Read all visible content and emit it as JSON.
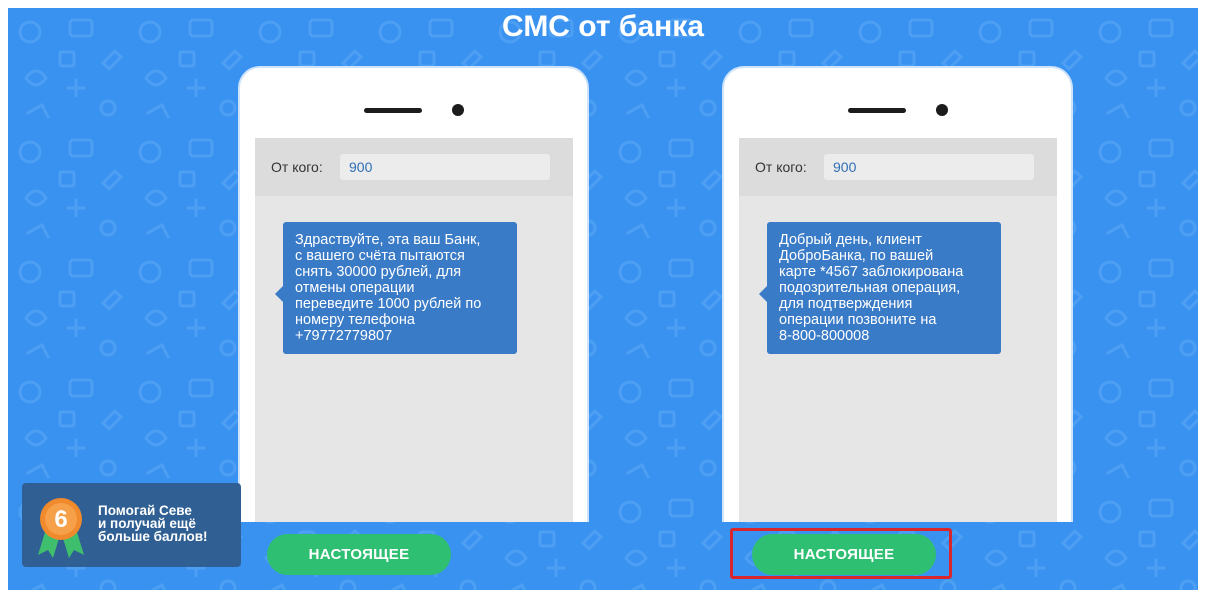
{
  "page": {
    "title": "СМС от банка",
    "background_color": "#3a92f0"
  },
  "sms_cards": [
    {
      "from_label": "От кого:",
      "from_value": "900",
      "message_lines": [
        "Здраствуйте, эта ваш Банк,",
        "с вашего счёта пытаются",
        "снять 30000 рублей, для",
        "отмены операции",
        "переведите 1000 рублей по",
        "номеру телефона",
        "+79772779807"
      ],
      "button_label": "НАСТОЯЩЕЕ"
    },
    {
      "from_label": "От кого:",
      "from_value": "900",
      "message_lines": [
        "Добрый день, клиент",
        "ДоброБанка, по вашей",
        "карте *4567 заблокирована",
        "подозрительная операция,",
        "для подтверждения",
        "операции позвоните на",
        "8-800-800008"
      ],
      "button_label": "НАСТОЯЩЕЕ",
      "button_highlighted": true
    }
  ],
  "reward_badge": {
    "number": "6",
    "lines": [
      "Помогай Севе",
      "и получай ещё",
      "больше баллов!"
    ],
    "icon": "medal-icon"
  },
  "colors": {
    "bubble": "#3a7bc7",
    "button": "#2fbf72",
    "highlight": "#d9262c",
    "badge": "#2f5f93",
    "medal": "#f08a2c"
  }
}
